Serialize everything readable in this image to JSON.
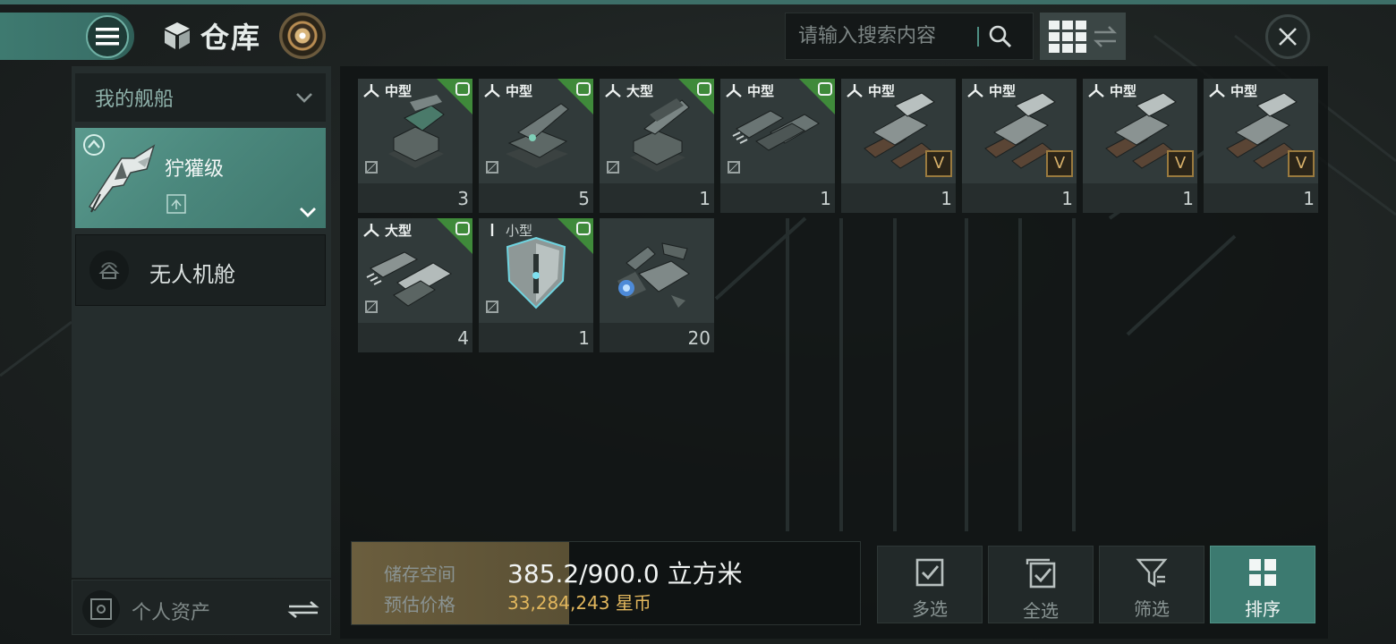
{
  "header": {
    "title": "仓库",
    "search_placeholder": "请输入搜索内容"
  },
  "sidebar": {
    "category_dropdown": "我的舰船",
    "ship_name": "狞獾级",
    "drone_bay": "无人机舱",
    "personal_assets": "个人资产"
  },
  "items": [
    {
      "size": "中型",
      "qty": "3",
      "slot": "turret",
      "grade": "O",
      "meta": ""
    },
    {
      "size": "中型",
      "qty": "5",
      "slot": "turret",
      "grade": "O",
      "meta": ""
    },
    {
      "size": "大型",
      "qty": "1",
      "slot": "turret",
      "grade": "O",
      "meta": ""
    },
    {
      "size": "中型",
      "qty": "1",
      "slot": "turret",
      "grade": "O",
      "meta": ""
    },
    {
      "size": "中型",
      "qty": "1",
      "slot": "turret",
      "grade": "",
      "meta": "V"
    },
    {
      "size": "中型",
      "qty": "1",
      "slot": "turret",
      "grade": "",
      "meta": "V"
    },
    {
      "size": "中型",
      "qty": "1",
      "slot": "turret",
      "grade": "",
      "meta": "V"
    },
    {
      "size": "中型",
      "qty": "1",
      "slot": "turret",
      "grade": "",
      "meta": "V"
    },
    {
      "size": "大型",
      "qty": "4",
      "slot": "turret",
      "grade": "O",
      "meta": ""
    },
    {
      "size": "小型",
      "qty": "1",
      "slot": "low",
      "grade": "O",
      "meta": ""
    },
    {
      "size": "",
      "qty": "20",
      "slot": "",
      "grade": "",
      "meta": ""
    }
  ],
  "footer": {
    "storage_label": "储存空间",
    "storage_value": "385.2/900.0 立方米",
    "storage_fill_pct": 42.8,
    "price_label": "预估价格",
    "price_value": "33,284,243 星币",
    "buttons": [
      {
        "label": "多选",
        "icon": "checkbox-icon"
      },
      {
        "label": "全选",
        "icon": "select-all-icon"
      },
      {
        "label": "筛选",
        "icon": "filter-icon"
      },
      {
        "label": "排序",
        "icon": "sort-grid-icon",
        "active": true
      }
    ]
  },
  "colors": {
    "accent_teal": "#3c7a70",
    "grade_green": "#3f8a3a",
    "price_gold": "#e2b75d"
  }
}
